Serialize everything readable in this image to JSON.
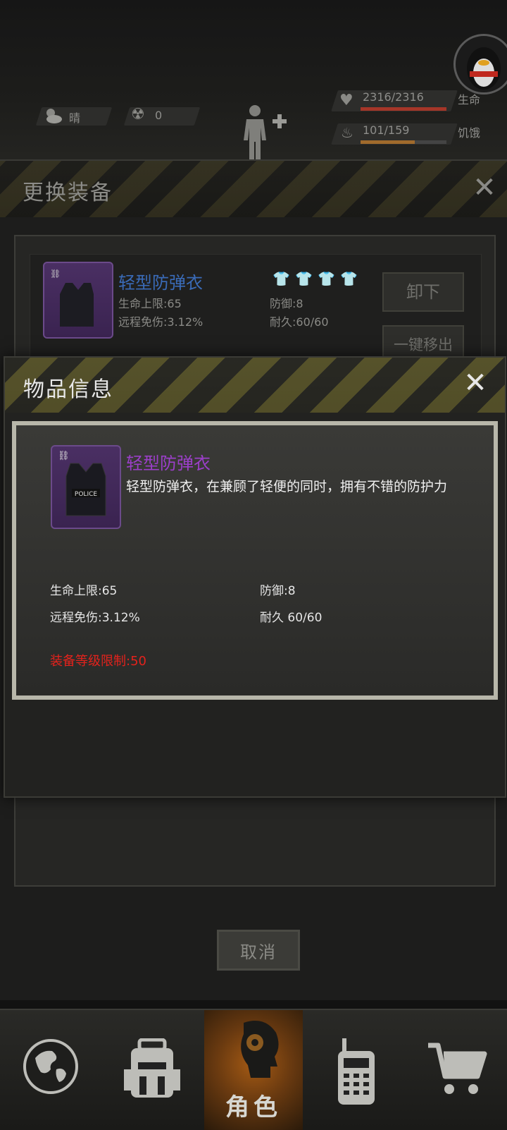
{
  "hud": {
    "weather_label": "晴",
    "radiation_value": "0",
    "health_value": "2316/2316",
    "health_label": "生命",
    "health_fraction": 1.0,
    "hunger_value": "101/159",
    "hunger_label": "饥饿",
    "hunger_fraction": 0.635
  },
  "change_dialog": {
    "title": "更换装备",
    "item": {
      "name": "轻型防弹衣",
      "stat_hp": "生命上限:65",
      "stat_defense": "防御:8",
      "stat_ranged": "远程免伤:3.12%",
      "stat_durability": "耐久:60/60"
    },
    "unequip_label": "卸下",
    "remove_all_label": "一键移出",
    "cancel_label": "取消"
  },
  "info_dialog": {
    "title": "物品信息",
    "item_name": "轻型防弹衣",
    "description": "轻型防弹衣，在兼顾了轻便的同时，拥有不错的防护力",
    "vest_text": "POLICE",
    "stat_hp": "生命上限:65",
    "stat_defense": "防御:8",
    "stat_ranged": "远程免伤:3.12%",
    "stat_durability": "耐久 60/60",
    "level_requirement": "装备等级限制:50"
  },
  "nav": {
    "active_label": "角色"
  },
  "colors": {
    "item_name_blue": "#3a6bb8",
    "item_name_purple": "#9b3fc9",
    "warning_red": "#e4221c",
    "health_red": "#c0392b",
    "hunger_orange": "#c9873a"
  }
}
